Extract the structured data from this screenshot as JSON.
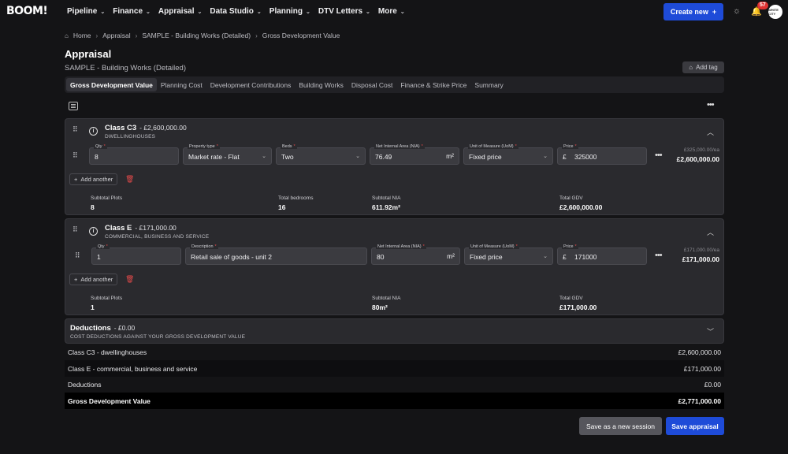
{
  "app": {
    "logo": "BOOM!"
  },
  "nav": {
    "items": [
      {
        "label": "Pipeline"
      },
      {
        "label": "Finance"
      },
      {
        "label": "Appraisal"
      },
      {
        "label": "Data Studio"
      },
      {
        "label": "Planning"
      },
      {
        "label": "DTV Letters"
      },
      {
        "label": "More"
      }
    ],
    "create_label": "Create new",
    "notification_count": "57",
    "avatar_text": "WHITE CITY"
  },
  "breadcrumb": [
    "Home",
    "Appraisal",
    "SAMPLE - Building Works (Detailed)",
    "Gross Development Value"
  ],
  "page": {
    "title": "Appraisal",
    "subtitle": "SAMPLE - Building Works (Detailed)",
    "add_tag": "Add tag"
  },
  "tabs": [
    "Gross Development Value",
    "Planning Cost",
    "Development Contributions",
    "Building Works",
    "Disposal Cost",
    "Finance & Strike Price",
    "Summary"
  ],
  "active_tab": "Gross Development Value",
  "class_c3": {
    "title": "Class C3",
    "amount": "- £2,600,000.00",
    "subtitle": "DWELLINGHOUSES",
    "fields": {
      "qty_label": "Qty",
      "qty": "8",
      "ptype_label": "Property type",
      "ptype": "Market rate - Flat",
      "beds_label": "Beds",
      "beds": "Two",
      "nia_label": "Net Internal Area (NIA)",
      "nia": "76.49",
      "nia_unit": "m²",
      "uom_label": "Unit of Measure (UoM)",
      "uom": "Fixed price",
      "price_label": "Price",
      "currency": "£",
      "price": "325000"
    },
    "unit_price_small": "£325,000.00/ea",
    "line_total": "£2,600,000.00",
    "add_another": "Add another",
    "stats": [
      {
        "label": "Subtotal Plots",
        "value": "8"
      },
      {
        "label": "Total bedrooms",
        "value": "16"
      },
      {
        "label": "Subtotal NIA",
        "value": "611.92m²"
      },
      {
        "label": "Total GDV",
        "value": "£2,600,000.00"
      }
    ]
  },
  "class_e": {
    "title": "Class E",
    "amount": "- £171,000.00",
    "subtitle": "COMMERCIAL, BUSINESS AND SERVICE",
    "fields": {
      "qty_label": "Qty",
      "qty": "1",
      "desc_label": "Description",
      "desc": "Retail sale of goods - unit 2",
      "nia_label": "Net Internal Area (NIA)",
      "nia": "80",
      "nia_unit": "m²",
      "uom_label": "Unit of Measure (UoM)",
      "uom": "Fixed price",
      "price_label": "Price",
      "currency": "£",
      "price": "171000"
    },
    "unit_price_small": "£171,000.00/ea",
    "line_total": "£171,000.00",
    "add_another": "Add another",
    "stats": [
      {
        "label": "Subtotal Plots",
        "value": "1"
      },
      {
        "label": "Subtotal NIA",
        "value": "80m²"
      },
      {
        "label": "Total GDV",
        "value": "£171,000.00"
      }
    ]
  },
  "deductions": {
    "title": "Deductions",
    "amount": "- £0.00",
    "subtitle": "COST DEDUCTIONS AGAINST YOUR GROSS DEVELOPMENT VALUE"
  },
  "summary": [
    {
      "label": "Class C3 - dwellinghouses",
      "value": "£2,600,000.00"
    },
    {
      "label": "Class E - commercial, business and service",
      "value": "£171,000.00"
    },
    {
      "label": "Deductions",
      "value": "£0.00"
    },
    {
      "label": "Gross Development Value",
      "value": "£2,771,000.00"
    }
  ],
  "actions": {
    "save_session": "Save as a new session",
    "save_appraisal": "Save appraisal"
  },
  "colors": {
    "accent": "#1e4bd8",
    "danger": "#e34a4a",
    "background": "#141416",
    "card": "#2a2a2e"
  }
}
